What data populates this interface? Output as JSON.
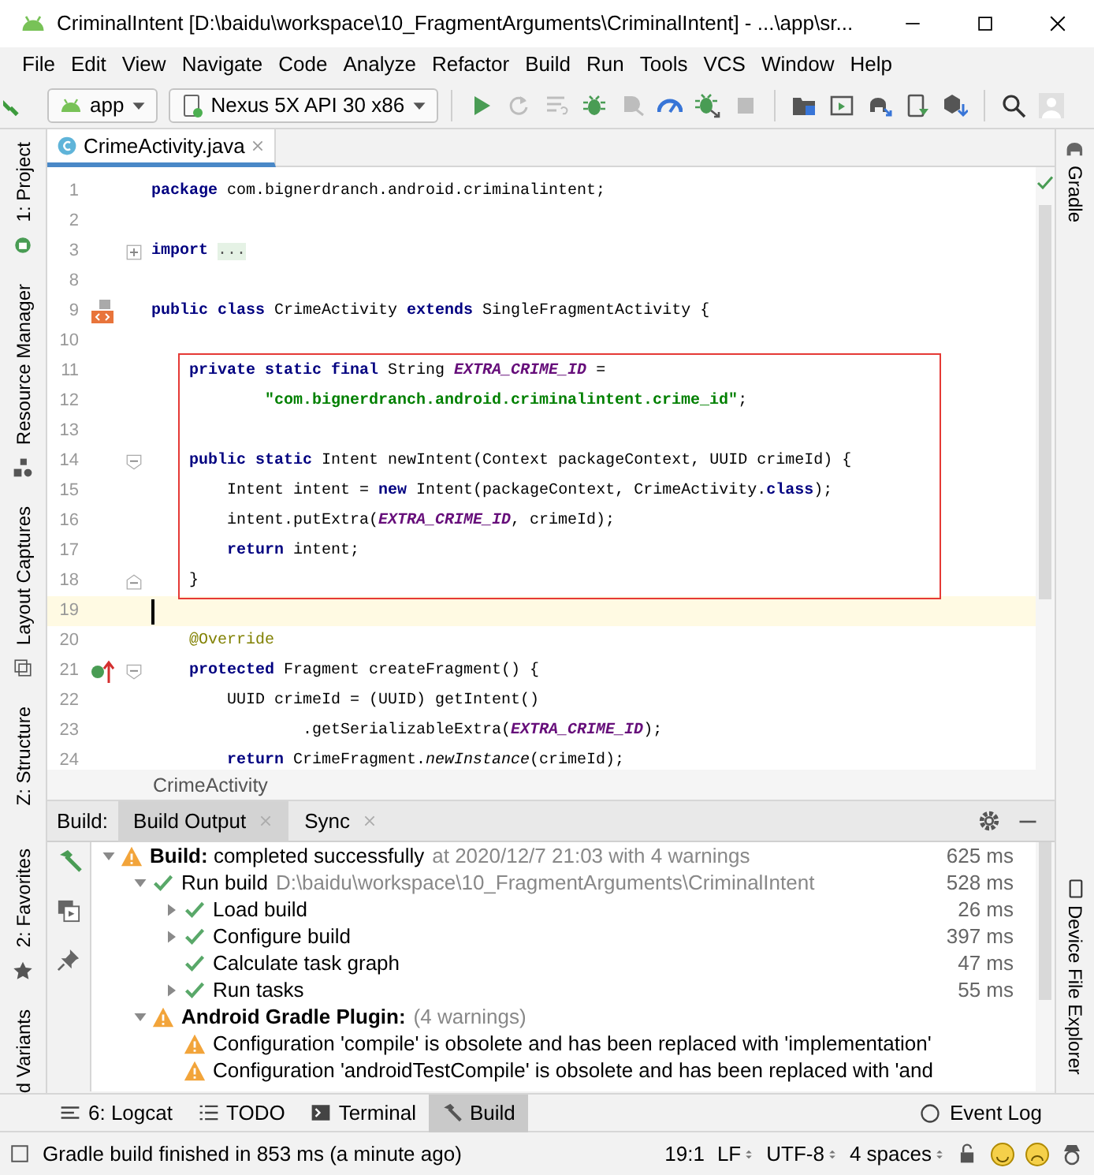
{
  "window": {
    "title": "CriminalIntent [D:\\baidu\\workspace\\10_FragmentArguments\\CriminalIntent] - ...\\app\\sr..."
  },
  "menu": [
    "File",
    "Edit",
    "View",
    "Navigate",
    "Code",
    "Analyze",
    "Refactor",
    "Build",
    "Run",
    "Tools",
    "VCS",
    "Window",
    "Help"
  ],
  "toolbar": {
    "run_config": "app",
    "device": "Nexus 5X API 30 x86",
    "button_groups": [
      [
        {
          "kind": "run",
          "disabled": false
        },
        {
          "kind": "apply-changes",
          "disabled": true
        },
        {
          "kind": "apply-code",
          "disabled": true
        },
        {
          "kind": "debug",
          "disabled": false
        },
        {
          "kind": "attach",
          "disabled": true
        },
        {
          "kind": "profile",
          "disabled": false
        },
        {
          "kind": "attach-debugger",
          "disabled": false
        },
        {
          "kind": "stop",
          "disabled": true
        }
      ],
      [
        {
          "kind": "project-structure",
          "disabled": false
        },
        {
          "kind": "layout-inspector",
          "disabled": false
        },
        {
          "kind": "sync",
          "disabled": false
        },
        {
          "kind": "avd",
          "disabled": false
        },
        {
          "kind": "sdk",
          "disabled": false
        }
      ],
      [
        {
          "kind": "search"
        },
        {
          "kind": "account"
        }
      ]
    ]
  },
  "left_tool_tabs_top": [
    {
      "label": "1: Project",
      "kind": "project"
    },
    {
      "label": "Resource Manager",
      "kind": "resources"
    },
    {
      "label": "Layout Captures",
      "kind": "captures"
    },
    {
      "label": "Z: Structure",
      "kind": "structure"
    }
  ],
  "left_tool_tabs_bottom": [
    {
      "label": "2: Favorites",
      "kind": "favorites"
    },
    {
      "label": "d Variants",
      "kind": "variants"
    }
  ],
  "right_tool_tabs": [
    {
      "label": "Gradle",
      "kind": "gradle"
    },
    {
      "label": "Device File Explorer",
      "kind": "device"
    }
  ],
  "editor": {
    "tabs": [
      {
        "label": "CrimeActivity.java",
        "selected": true
      }
    ],
    "lines": [
      {
        "number": "1",
        "tokens": [
          {
            "kind": "keyword",
            "text": "package"
          },
          {
            "kind": "plain",
            "text": " com.bignerdranch.android.criminalintent;"
          }
        ]
      },
      {
        "number": "2"
      },
      {
        "number": "3",
        "fold_collapsed": true,
        "tokens": [
          {
            "kind": "keyword",
            "text": "import "
          },
          {
            "kind": "folded",
            "text": "..."
          }
        ]
      },
      {
        "number": "8"
      },
      {
        "number": "9",
        "class_marker": true,
        "tokens": [
          {
            "kind": "keyword",
            "text": "public class"
          },
          {
            "kind": "plain",
            "text": " CrimeActivity "
          },
          {
            "kind": "keyword",
            "text": "extends"
          },
          {
            "kind": "plain",
            "text": " SingleFragmentActivity {"
          }
        ]
      },
      {
        "number": "10"
      },
      {
        "kind": "frame",
        "lines": [
          {
            "number": "11",
            "tokens": [
              {
                "kind": "keyword",
                "text": "    private static final"
              },
              {
                "kind": "plain",
                "text": " String "
              },
              {
                "kind": "constant",
                "text": "EXTRA_CRIME_ID"
              },
              {
                "kind": "plain",
                "text": " ="
              }
            ]
          },
          {
            "number": "12",
            "tokens": [
              {
                "kind": "string",
                "text": "            \"com.bignerdranch.android.criminalintent.crime_id\""
              },
              {
                "kind": "plain",
                "text": ";"
              }
            ]
          },
          {
            "number": "13"
          },
          {
            "number": "14",
            "fold_start": true,
            "tokens": [
              {
                "kind": "keyword",
                "text": "    public static"
              },
              {
                "kind": "plain",
                "text": " Intent newIntent(Context packageContext, UUID crimeId) {"
              }
            ]
          },
          {
            "number": "15",
            "tokens": [
              {
                "kind": "plain",
                "text": "        Intent intent = "
              },
              {
                "kind": "keyword",
                "text": "new"
              },
              {
                "kind": "plain",
                "text": " Intent(packageContext, CrimeActivity."
              },
              {
                "kind": "keyword",
                "text": "class"
              },
              {
                "kind": "plain",
                "text": ");"
              }
            ]
          },
          {
            "number": "16",
            "tokens": [
              {
                "kind": "plain",
                "text": "        intent.putExtra("
              },
              {
                "kind": "constant",
                "text": "EXTRA_CRIME_ID"
              },
              {
                "kind": "plain",
                "text": ", crimeId);"
              }
            ]
          },
          {
            "number": "17",
            "tokens": [
              {
                "kind": "keyword",
                "text": "        return"
              },
              {
                "kind": "plain",
                "text": " intent;"
              }
            ]
          },
          {
            "number": "18",
            "fold_end": true,
            "tokens": [
              {
                "kind": "plain",
                "text": "    }"
              }
            ]
          }
        ]
      },
      {
        "number": "19",
        "current": true
      },
      {
        "number": "20",
        "tokens": [
          {
            "kind": "annotation",
            "text": "    @Override"
          }
        ]
      },
      {
        "number": "21",
        "override_marker": true,
        "fold_start": true,
        "tokens": [
          {
            "kind": "keyword",
            "text": "    protected"
          },
          {
            "kind": "plain",
            "text": " Fragment createFragment() {"
          }
        ]
      },
      {
        "number": "22",
        "tokens": [
          {
            "kind": "plain",
            "text": "        UUID crimeId = (UUID) getIntent()"
          }
        ]
      },
      {
        "number": "23",
        "tokens": [
          {
            "kind": "plain",
            "text": "                .getSerializableExtra("
          },
          {
            "kind": "constant",
            "text": "EXTRA_CRIME_ID"
          },
          {
            "kind": "plain",
            "text": ");"
          }
        ]
      },
      {
        "number": "24",
        "tokens": [
          {
            "kind": "keyword",
            "text": "        return"
          },
          {
            "kind": "plain",
            "text": " CrimeFragment."
          },
          {
            "kind": "static",
            "text": "newInstance"
          },
          {
            "kind": "plain",
            "text": "(crimeId);"
          }
        ]
      }
    ],
    "breadcrumb": "CrimeActivity"
  },
  "build_panel": {
    "title": "Build:",
    "tabs": [
      {
        "label": "Build Output",
        "selected": true
      },
      {
        "label": "Sync",
        "selected": false
      }
    ],
    "tree": [
      {
        "kind": "warning",
        "label": "**Build:** completed successfully",
        "detail": "at 2020/12/7 21:03  with 4 warnings",
        "time": "625 ms",
        "expanded": true,
        "children": [
          {
            "kind": "success",
            "label": "Run build",
            "detail": "D:\\baidu\\workspace\\10_FragmentArguments\\CriminalIntent",
            "time": "528 ms",
            "expanded": true,
            "children": [
              {
                "kind": "success",
                "label": "Load build",
                "time": "26 ms",
                "expanded": false
              },
              {
                "kind": "success",
                "label": "Configure build",
                "time": "397 ms",
                "expanded": false
              },
              {
                "kind": "success",
                "label": "Calculate task graph",
                "time": "47 ms"
              },
              {
                "kind": "success",
                "label": "Run tasks",
                "time": "55 ms",
                "expanded": false
              }
            ]
          },
          {
            "kind": "warning",
            "label": "**Android Gradle Plugin:**",
            "detail": "(4 warnings)",
            "expanded": true,
            "children": [
              {
                "kind": "warning",
                "label": "Configuration 'compile' is obsolete and has been replaced with 'implementation'"
              },
              {
                "kind": "warning",
                "label": "Configuration 'androidTestCompile' is obsolete and has been replaced with 'and"
              }
            ]
          }
        ]
      }
    ]
  },
  "bottom_tabs": [
    {
      "label": "6: Logcat",
      "kind": "logcat",
      "selected": false
    },
    {
      "label": "TODO",
      "kind": "todo",
      "selected": false
    },
    {
      "label": "Terminal",
      "kind": "terminal",
      "selected": false
    },
    {
      "label": "Build",
      "kind": "build",
      "selected": true
    }
  ],
  "event_log": "Event Log",
  "status_bar": {
    "message": "Gradle build finished in 853 ms (a minute ago)",
    "position": "19:1",
    "line_separator": "LF",
    "encoding": "UTF-8",
    "indent": "4 spaces"
  }
}
